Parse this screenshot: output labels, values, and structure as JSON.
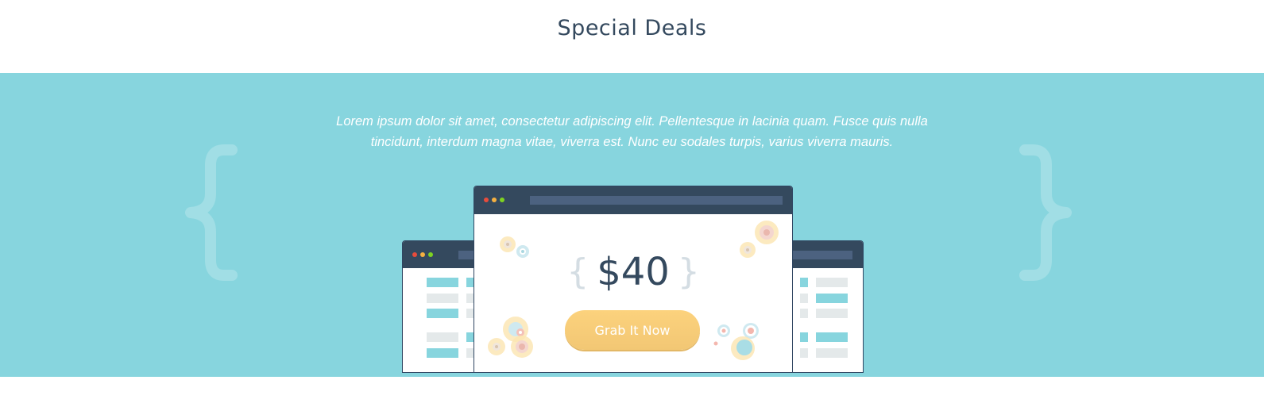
{
  "section": {
    "title": "Special Deals",
    "description": "Lorem ipsum dolor sit amet, consectetur adipiscing elit. Pellentesque in lacinia quam. Fusce quis nulla tincidunt, interdum magna vitae, viverra est. Nunc eu sodales turpis, varius viverra mauris."
  },
  "deal": {
    "price": "$40",
    "button_label": "Grab It Now"
  },
  "colors": {
    "band": "#87d5de",
    "dark": "#34495e",
    "accent": "#fcd27d",
    "dot_red": "#e74c3c",
    "dot_yellow": "#f5b041",
    "dot_green": "#7ed321"
  },
  "icons": {
    "left_decoration": "curly-brace-open-icon",
    "right_decoration": "curly-brace-close-icon",
    "window_controls": "window-dots-icon",
    "decor": "circles-decoration-icon"
  }
}
